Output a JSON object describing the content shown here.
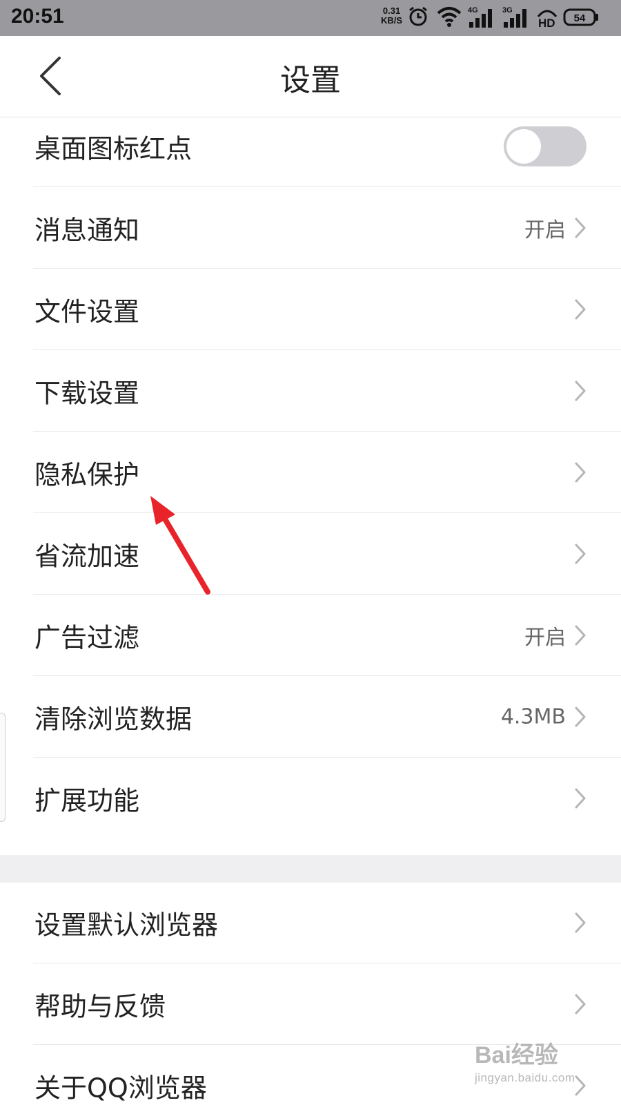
{
  "status_bar": {
    "time": "20:51",
    "speed_value": "0.31",
    "speed_unit": "KB/S",
    "icons": [
      "alarm-icon",
      "wifi-icon",
      "signal-4g-icon",
      "signal-3g-icon",
      "hd-icon",
      "battery-icon"
    ],
    "network_1": "4G",
    "network_2": "3G",
    "hd_label": "HD",
    "battery": "54"
  },
  "header": {
    "title": "设置"
  },
  "settings": {
    "items": [
      {
        "label": "桌面图标红点",
        "control": "toggle",
        "toggle_on": false
      },
      {
        "label": "消息通知",
        "value": "开启"
      },
      {
        "label": "文件设置"
      },
      {
        "label": "下载设置"
      },
      {
        "label": "隐私保护"
      },
      {
        "label": "省流加速"
      },
      {
        "label": "广告过滤",
        "value": "开启"
      },
      {
        "label": "清除浏览数据",
        "value": "4.3MB"
      },
      {
        "label": "扩展功能"
      }
    ],
    "items2": [
      {
        "label": "设置默认浏览器"
      },
      {
        "label": "帮助与反馈"
      },
      {
        "label": "关于QQ浏览器"
      }
    ]
  },
  "annotation": {
    "arrow_color": "#e8232a",
    "points_to": "隐私保护"
  },
  "watermark": {
    "brand": "Bai经验",
    "url": "jingyan.baidu.com"
  },
  "colors": {
    "status_bar_bg": "#9a9a9e",
    "section_gap_bg": "#efeff2",
    "toggle_off_bg": "#cfcfd3"
  }
}
